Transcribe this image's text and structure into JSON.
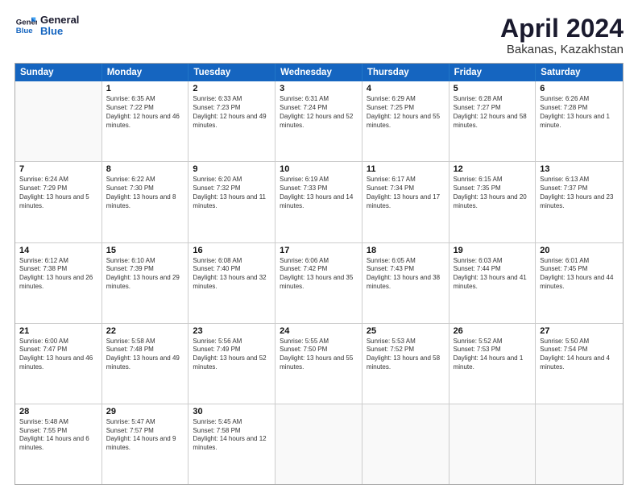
{
  "logo": {
    "line1": "General",
    "line2": "Blue"
  },
  "title": "April 2024",
  "subtitle": "Bakanas, Kazakhstan",
  "days": [
    "Sunday",
    "Monday",
    "Tuesday",
    "Wednesday",
    "Thursday",
    "Friday",
    "Saturday"
  ],
  "weeks": [
    [
      {
        "day": "",
        "sunrise": "",
        "sunset": "",
        "daylight": ""
      },
      {
        "day": "1",
        "sunrise": "Sunrise: 6:35 AM",
        "sunset": "Sunset: 7:22 PM",
        "daylight": "Daylight: 12 hours and 46 minutes."
      },
      {
        "day": "2",
        "sunrise": "Sunrise: 6:33 AM",
        "sunset": "Sunset: 7:23 PM",
        "daylight": "Daylight: 12 hours and 49 minutes."
      },
      {
        "day": "3",
        "sunrise": "Sunrise: 6:31 AM",
        "sunset": "Sunset: 7:24 PM",
        "daylight": "Daylight: 12 hours and 52 minutes."
      },
      {
        "day": "4",
        "sunrise": "Sunrise: 6:29 AM",
        "sunset": "Sunset: 7:25 PM",
        "daylight": "Daylight: 12 hours and 55 minutes."
      },
      {
        "day": "5",
        "sunrise": "Sunrise: 6:28 AM",
        "sunset": "Sunset: 7:27 PM",
        "daylight": "Daylight: 12 hours and 58 minutes."
      },
      {
        "day": "6",
        "sunrise": "Sunrise: 6:26 AM",
        "sunset": "Sunset: 7:28 PM",
        "daylight": "Daylight: 13 hours and 1 minute."
      }
    ],
    [
      {
        "day": "7",
        "sunrise": "Sunrise: 6:24 AM",
        "sunset": "Sunset: 7:29 PM",
        "daylight": "Daylight: 13 hours and 5 minutes."
      },
      {
        "day": "8",
        "sunrise": "Sunrise: 6:22 AM",
        "sunset": "Sunset: 7:30 PM",
        "daylight": "Daylight: 13 hours and 8 minutes."
      },
      {
        "day": "9",
        "sunrise": "Sunrise: 6:20 AM",
        "sunset": "Sunset: 7:32 PM",
        "daylight": "Daylight: 13 hours and 11 minutes."
      },
      {
        "day": "10",
        "sunrise": "Sunrise: 6:19 AM",
        "sunset": "Sunset: 7:33 PM",
        "daylight": "Daylight: 13 hours and 14 minutes."
      },
      {
        "day": "11",
        "sunrise": "Sunrise: 6:17 AM",
        "sunset": "Sunset: 7:34 PM",
        "daylight": "Daylight: 13 hours and 17 minutes."
      },
      {
        "day": "12",
        "sunrise": "Sunrise: 6:15 AM",
        "sunset": "Sunset: 7:35 PM",
        "daylight": "Daylight: 13 hours and 20 minutes."
      },
      {
        "day": "13",
        "sunrise": "Sunrise: 6:13 AM",
        "sunset": "Sunset: 7:37 PM",
        "daylight": "Daylight: 13 hours and 23 minutes."
      }
    ],
    [
      {
        "day": "14",
        "sunrise": "Sunrise: 6:12 AM",
        "sunset": "Sunset: 7:38 PM",
        "daylight": "Daylight: 13 hours and 26 minutes."
      },
      {
        "day": "15",
        "sunrise": "Sunrise: 6:10 AM",
        "sunset": "Sunset: 7:39 PM",
        "daylight": "Daylight: 13 hours and 29 minutes."
      },
      {
        "day": "16",
        "sunrise": "Sunrise: 6:08 AM",
        "sunset": "Sunset: 7:40 PM",
        "daylight": "Daylight: 13 hours and 32 minutes."
      },
      {
        "day": "17",
        "sunrise": "Sunrise: 6:06 AM",
        "sunset": "Sunset: 7:42 PM",
        "daylight": "Daylight: 13 hours and 35 minutes."
      },
      {
        "day": "18",
        "sunrise": "Sunrise: 6:05 AM",
        "sunset": "Sunset: 7:43 PM",
        "daylight": "Daylight: 13 hours and 38 minutes."
      },
      {
        "day": "19",
        "sunrise": "Sunrise: 6:03 AM",
        "sunset": "Sunset: 7:44 PM",
        "daylight": "Daylight: 13 hours and 41 minutes."
      },
      {
        "day": "20",
        "sunrise": "Sunrise: 6:01 AM",
        "sunset": "Sunset: 7:45 PM",
        "daylight": "Daylight: 13 hours and 44 minutes."
      }
    ],
    [
      {
        "day": "21",
        "sunrise": "Sunrise: 6:00 AM",
        "sunset": "Sunset: 7:47 PM",
        "daylight": "Daylight: 13 hours and 46 minutes."
      },
      {
        "day": "22",
        "sunrise": "Sunrise: 5:58 AM",
        "sunset": "Sunset: 7:48 PM",
        "daylight": "Daylight: 13 hours and 49 minutes."
      },
      {
        "day": "23",
        "sunrise": "Sunrise: 5:56 AM",
        "sunset": "Sunset: 7:49 PM",
        "daylight": "Daylight: 13 hours and 52 minutes."
      },
      {
        "day": "24",
        "sunrise": "Sunrise: 5:55 AM",
        "sunset": "Sunset: 7:50 PM",
        "daylight": "Daylight: 13 hours and 55 minutes."
      },
      {
        "day": "25",
        "sunrise": "Sunrise: 5:53 AM",
        "sunset": "Sunset: 7:52 PM",
        "daylight": "Daylight: 13 hours and 58 minutes."
      },
      {
        "day": "26",
        "sunrise": "Sunrise: 5:52 AM",
        "sunset": "Sunset: 7:53 PM",
        "daylight": "Daylight: 14 hours and 1 minute."
      },
      {
        "day": "27",
        "sunrise": "Sunrise: 5:50 AM",
        "sunset": "Sunset: 7:54 PM",
        "daylight": "Daylight: 14 hours and 4 minutes."
      }
    ],
    [
      {
        "day": "28",
        "sunrise": "Sunrise: 5:48 AM",
        "sunset": "Sunset: 7:55 PM",
        "daylight": "Daylight: 14 hours and 6 minutes."
      },
      {
        "day": "29",
        "sunrise": "Sunrise: 5:47 AM",
        "sunset": "Sunset: 7:57 PM",
        "daylight": "Daylight: 14 hours and 9 minutes."
      },
      {
        "day": "30",
        "sunrise": "Sunrise: 5:45 AM",
        "sunset": "Sunset: 7:58 PM",
        "daylight": "Daylight: 14 hours and 12 minutes."
      },
      {
        "day": "",
        "sunrise": "",
        "sunset": "",
        "daylight": ""
      },
      {
        "day": "",
        "sunrise": "",
        "sunset": "",
        "daylight": ""
      },
      {
        "day": "",
        "sunrise": "",
        "sunset": "",
        "daylight": ""
      },
      {
        "day": "",
        "sunrise": "",
        "sunset": "",
        "daylight": ""
      }
    ]
  ]
}
